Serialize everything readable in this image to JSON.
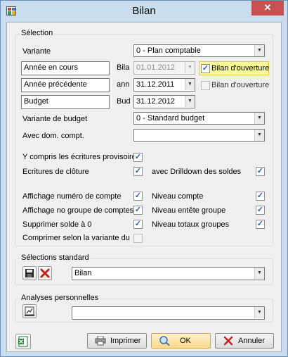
{
  "window": {
    "title": "Bilan",
    "close_glyph": "✕"
  },
  "selection": {
    "legend": "Sélection",
    "variante_label": "Variante",
    "variante_value": "0 - Plan comptable",
    "row1": {
      "left_value": "Année en cours",
      "mid_label": "Bila",
      "date": "01.01.2012",
      "check_label": "Bilan d'ouverture"
    },
    "row2": {
      "left_value": "Année précédente",
      "mid_label": "ann",
      "date": "31.12.2011",
      "check_label": "Bilan d'ouverture"
    },
    "row3": {
      "left_value": "Budget",
      "mid_label": "Bud",
      "date": "31.12.2012"
    },
    "budget_variant_label": "Variante de budget",
    "budget_variant_value": "0 - Standard budget",
    "dom_label": "Avec dom.  compt.",
    "dom_value": "",
    "provisional_label": "Y compris les écritures provisoires",
    "closing_label": "Ecritures de clôture",
    "drilldown_label": "avec Drilldown des soldes",
    "show_account_number_label": "Affichage numéro de compte",
    "level_account_label": "Niveau compte",
    "show_group_number_label": "Affichage no groupe de comptes",
    "level_group_header_label": "Niveau entête groupe",
    "delete_zero_label": "Supprimer solde à 0",
    "level_group_totals_label": "Niveau totaux groupes",
    "compress_label": "Comprimer selon la variante du"
  },
  "standard": {
    "legend": "Sélections standard",
    "value": "Bilan"
  },
  "personal": {
    "legend": "Analyses personnelles",
    "value": ""
  },
  "buttons": {
    "print": "Imprimer",
    "ok": "OK",
    "cancel": "Annuler"
  },
  "checked_glyph": "✓",
  "arrow_glyph": "▼",
  "colors": {
    "title_bar": "#c9ddef",
    "close_button": "#c75050",
    "highlight": "#fbfb9c",
    "ok_button": "#fbd98a"
  }
}
